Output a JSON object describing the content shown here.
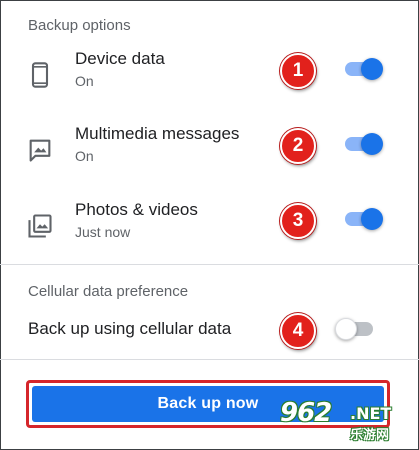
{
  "backup": {
    "header": "Backup options",
    "items": [
      {
        "title": "Device data",
        "subtitle": "On",
        "icon": "phone-icon",
        "badge": "1",
        "enabled": true
      },
      {
        "title": "Multimedia messages",
        "subtitle": "On",
        "icon": "image-message-icon",
        "badge": "2",
        "enabled": true
      },
      {
        "title": "Photos & videos",
        "subtitle": "Just now",
        "icon": "photo-library-icon",
        "badge": "3",
        "enabled": true
      }
    ]
  },
  "cellular": {
    "header": "Cellular data preference",
    "label": "Back up using cellular data",
    "badge": "4",
    "enabled": false
  },
  "action": {
    "label": "Back up now"
  },
  "watermark": {
    "logo": "962",
    "suffix": ".NET",
    "subtitle": "乐游网"
  },
  "colors": {
    "accent": "#1a73e8",
    "toggle_track_on": "#8ab4f8",
    "badge": "#e2211c",
    "highlight_outline": "#d5262b"
  }
}
